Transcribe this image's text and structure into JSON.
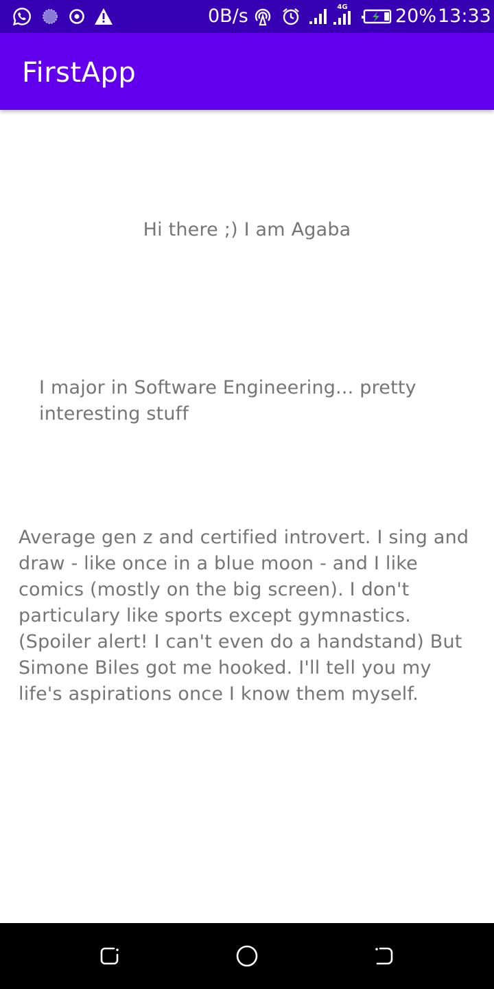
{
  "status_bar": {
    "network_speed": "0B/s",
    "network_type": "4G",
    "battery_percent": "20%",
    "time": "13:33",
    "battery_level": 0.2,
    "left_icons": [
      "whatsapp-icon",
      "loading-icon",
      "target-icon",
      "warning-icon"
    ],
    "right_icons": [
      "hotspot-icon",
      "alarm-icon",
      "signal-icon",
      "signal-4g-icon",
      "battery-charging-icon"
    ]
  },
  "app_bar": {
    "title": "FirstApp",
    "color": "#6200ee"
  },
  "content": {
    "greeting": "Hi there ;) I am Agaba",
    "major": "I major in Software Engineering... pretty interesting stuff",
    "bio": "Average gen z and certified introvert. I sing and draw - like once in a blue moon - and I like comics (mostly on the big screen). I don't particulary like sports except gymnastics. (Spoiler alert! I can't even do a handstand) But Simone Biles got me hooked. I'll tell you my life's aspirations once I know them myself."
  },
  "nav_bar": {
    "buttons": [
      "recents-icon",
      "home-icon",
      "back-icon"
    ]
  },
  "colors": {
    "status_bar": "#3700b3",
    "app_bar": "#6200ee",
    "text": "#757575",
    "background": "#ffffff"
  }
}
